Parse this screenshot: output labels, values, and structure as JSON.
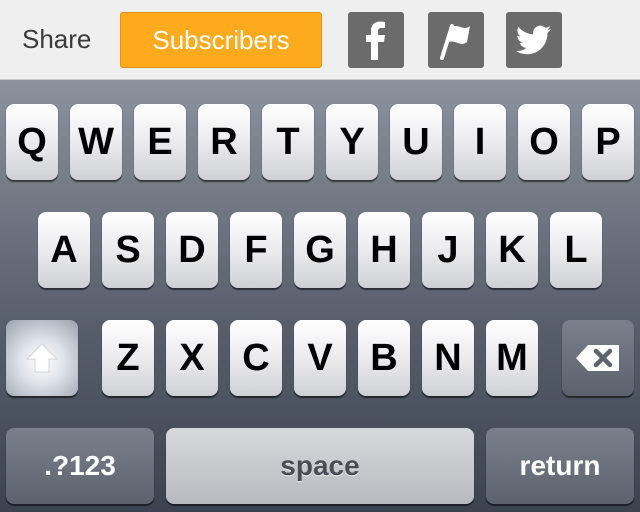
{
  "share_bar": {
    "share_label": "Share",
    "subscribers_label": "Subscribers",
    "icons": [
      "facebook-icon",
      "flag-icon",
      "twitter-icon"
    ],
    "colors": {
      "accent": "#fdab1d",
      "social_button": "#6b6b6b"
    }
  },
  "keyboard": {
    "row1": [
      "Q",
      "W",
      "E",
      "R",
      "T",
      "Y",
      "U",
      "I",
      "O",
      "P"
    ],
    "row2": [
      "A",
      "S",
      "D",
      "F",
      "G",
      "H",
      "J",
      "K",
      "L"
    ],
    "row3": [
      "Z",
      "X",
      "C",
      "V",
      "B",
      "N",
      "M"
    ],
    "numbers_label": ".?123",
    "space_label": "space",
    "return_label": "return",
    "icons": [
      "shift-icon",
      "backspace-icon"
    ]
  }
}
